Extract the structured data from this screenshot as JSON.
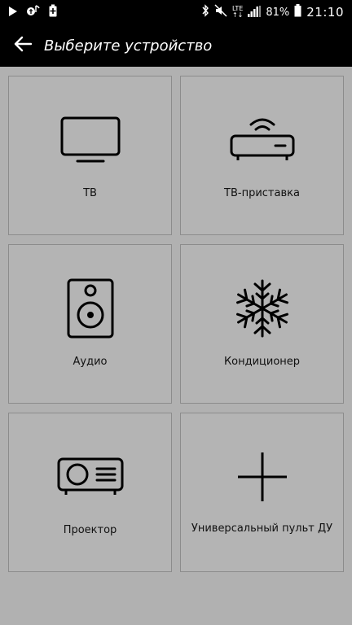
{
  "status_bar": {
    "left_icons": [
      "play-icon",
      "music-icon",
      "battery-saver-icon"
    ],
    "right_icons": [
      "bluetooth-icon",
      "mute-icon",
      "lte-icon",
      "signal-icon",
      "battery-icon"
    ],
    "lte_text": "LTE",
    "lte_sub": "↑↓",
    "battery_percent": "81%",
    "time": "21:10"
  },
  "app_bar": {
    "back_icon": "arrow-left-icon",
    "title": "Выберите устройство"
  },
  "devices": [
    {
      "label": "ТВ",
      "icon": "tv-icon"
    },
    {
      "label": "ТВ-приставка",
      "icon": "settop-box-icon"
    },
    {
      "label": "Аудио",
      "icon": "speaker-icon"
    },
    {
      "label": "Кондиционер",
      "icon": "snowflake-icon"
    },
    {
      "label": "Проектор",
      "icon": "projector-icon"
    },
    {
      "label": "Универсальный пульт ДУ",
      "icon": "plus-icon"
    }
  ],
  "colors": {
    "background": "#b1b1b1",
    "tile": "#b4b4b4",
    "bar": "#000000",
    "icon": "#000000"
  }
}
